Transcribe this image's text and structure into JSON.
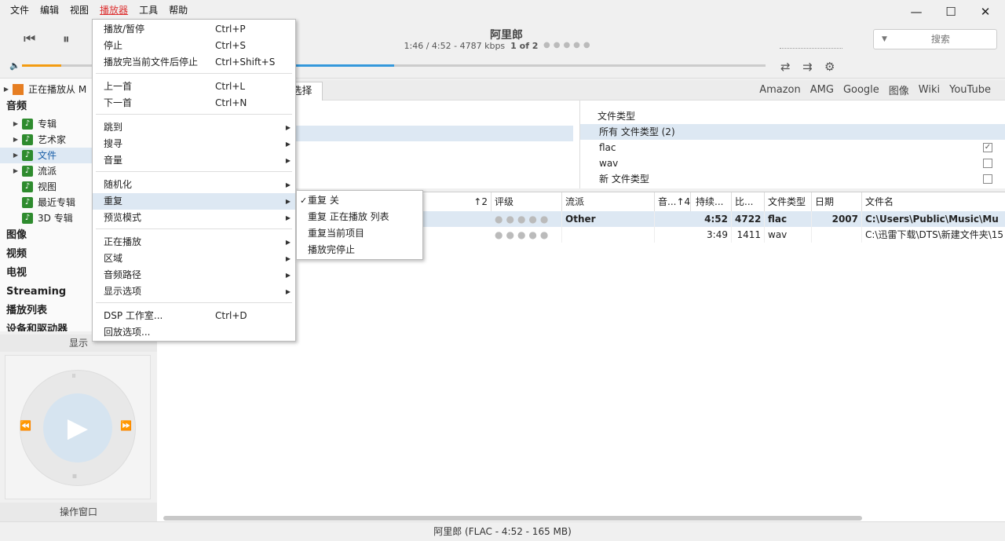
{
  "menubar": {
    "items": [
      "文件",
      "编辑",
      "视图",
      "播放器",
      "工具",
      "帮助"
    ],
    "active": "播放器"
  },
  "window": {
    "minimize_icon": "minimize-icon",
    "maximize_icon": "maximize-icon",
    "close_icon": "close-icon"
  },
  "player": {
    "title": "阿里郎",
    "position": "1:46 / 4:52 - 4787 kbps",
    "track_count": "1 of 2",
    "volume_fraction": 0.55,
    "progress_fraction": 0.39,
    "accent_volume": "#f39c12",
    "accent_progress": "#3498db"
  },
  "search": {
    "placeholder": "搜索"
  },
  "sidebar": {
    "now_playing": "正在播放从 M",
    "audio_header": "音频",
    "audio_items": [
      "专辑",
      "艺术家",
      "文件",
      "流派",
      "视图",
      "最近专辑",
      "3D 专辑"
    ],
    "selected": "文件",
    "sections": [
      "图像",
      "视频",
      "电视",
      "Streaming",
      "播放列表",
      "设备和驱动器"
    ],
    "display_label": "显示",
    "op_window_label": "操作窗口"
  },
  "linkbar": {
    "links": [
      "Amazon",
      "AMG",
      "Google",
      "图像",
      "Wiki",
      "YouTube"
    ],
    "tab_label": "类选择"
  },
  "filetype_pane": {
    "header": "文件类型",
    "rows": [
      {
        "label": "所有 文件类型 (2)",
        "checked": null,
        "selected": true
      },
      {
        "label": "flac",
        "checked": true,
        "selected": false
      },
      {
        "label": "wav",
        "checked": false,
        "selected": false
      },
      {
        "label": "新 文件类型",
        "checked": false,
        "selected": false
      }
    ]
  },
  "table": {
    "headers": [
      "2",
      "评级",
      "流派",
      "音...",
      "4",
      "持续...",
      "比...",
      "文件类型",
      "日期",
      "文件名"
    ],
    "rows": [
      {
        "genre": "Other",
        "duration": "4:52",
        "bitrate": "4722",
        "filetype": "flac",
        "date": "2007",
        "filename": "C:\\Users\\Public\\Music\\Mu"
      },
      {
        "genre": "",
        "duration": "3:49",
        "bitrate": "1411",
        "filetype": "wav",
        "date": "",
        "filename": "C:\\迅雷下载\\DTS\\新建文件夹\\15"
      }
    ]
  },
  "status": {
    "text": "阿里郎 (FLAC - 4:52 - 165 MB)"
  },
  "player_menu": {
    "items": [
      {
        "label": "播放/暂停",
        "shortcut": "Ctrl+P",
        "sub": false
      },
      {
        "label": "停止",
        "shortcut": "Ctrl+S",
        "sub": false
      },
      {
        "label": "播放完当前文件后停止",
        "shortcut": "Ctrl+Shift+S",
        "sub": false
      },
      {
        "label": "上一首",
        "shortcut": "Ctrl+L",
        "sub": false
      },
      {
        "label": "下一首",
        "shortcut": "Ctrl+N",
        "sub": false
      },
      {
        "label": "跳到",
        "shortcut": "",
        "sub": true
      },
      {
        "label": "搜寻",
        "shortcut": "",
        "sub": true
      },
      {
        "label": "音量",
        "shortcut": "",
        "sub": true
      },
      {
        "label": "随机化",
        "shortcut": "",
        "sub": true
      },
      {
        "label": "重复",
        "shortcut": "",
        "sub": true
      },
      {
        "label": "预览模式",
        "shortcut": "",
        "sub": true
      },
      {
        "label": "正在播放",
        "shortcut": "",
        "sub": true
      },
      {
        "label": "区域",
        "shortcut": "",
        "sub": true
      },
      {
        "label": "音频路径",
        "shortcut": "",
        "sub": true
      },
      {
        "label": "显示选项",
        "shortcut": "",
        "sub": true
      },
      {
        "label": "DSP 工作室...",
        "shortcut": "Ctrl+D",
        "sub": false
      },
      {
        "label": "回放选项...",
        "shortcut": "",
        "sub": false
      }
    ],
    "highlighted": "重复"
  },
  "repeat_submenu": {
    "items": [
      {
        "label": "重复 关",
        "checked": true
      },
      {
        "label": "重复 正在播放 列表",
        "checked": false
      },
      {
        "label": "重复当前项目",
        "checked": false
      },
      {
        "label": "播放完停止",
        "checked": false
      }
    ]
  }
}
